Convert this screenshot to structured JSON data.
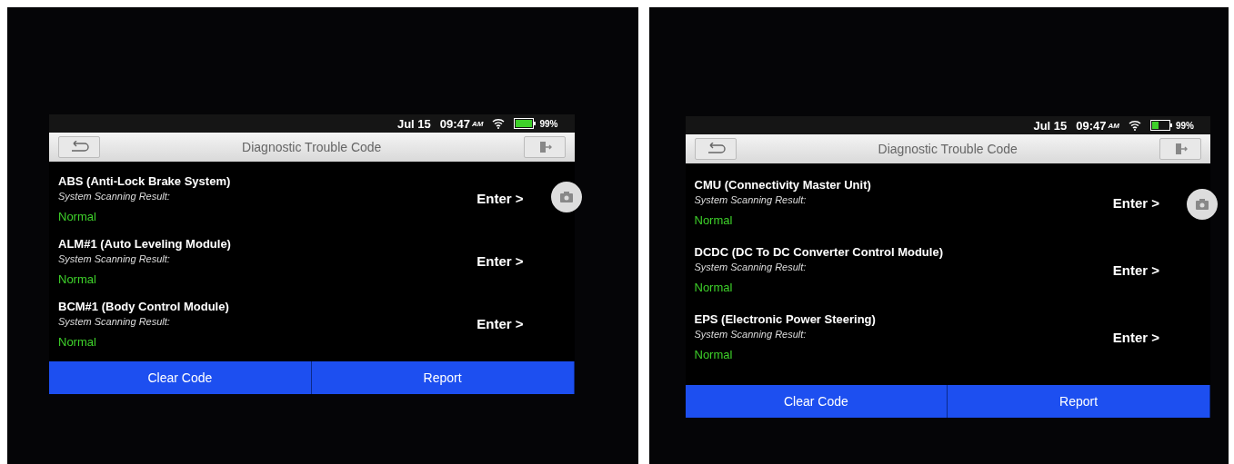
{
  "screens": [
    {
      "status_bar": {
        "date": "Jul 15",
        "time": "09:47",
        "ampm": "AM",
        "battery": "99%"
      },
      "title": "Diagnostic Trouble Code",
      "systems": [
        {
          "name": "ABS (Anti-Lock Brake System)",
          "result_label": "System Scanning Result:",
          "result": "Normal",
          "action": "Enter >"
        },
        {
          "name": "ALM#1 (Auto Leveling Module)",
          "result_label": "System Scanning Result:",
          "result": "Normal",
          "action": "Enter >"
        },
        {
          "name": "BCM#1 (Body Control Module)",
          "result_label": "System Scanning Result:",
          "result": "Normal",
          "action": "Enter >"
        }
      ],
      "buttons": [
        "Clear Code",
        "Report"
      ]
    },
    {
      "status_bar": {
        "date": "Jul 15",
        "time": "09:47",
        "ampm": "AM",
        "battery": "99%"
      },
      "title": "Diagnostic Trouble Code",
      "systems": [
        {
          "name": "CMU (Connectivity Master Unit)",
          "result_label": "System Scanning Result:",
          "result": "Normal",
          "action": "Enter >"
        },
        {
          "name": "DCDC (DC To DC Converter Control Module)",
          "result_label": "System Scanning Result:",
          "result": "Normal",
          "action": "Enter >"
        },
        {
          "name": "EPS (Electronic Power Steering)",
          "result_label": "System Scanning Result:",
          "result": "Normal",
          "action": "Enter >"
        }
      ],
      "buttons": [
        "Clear Code",
        "Report"
      ]
    }
  ]
}
